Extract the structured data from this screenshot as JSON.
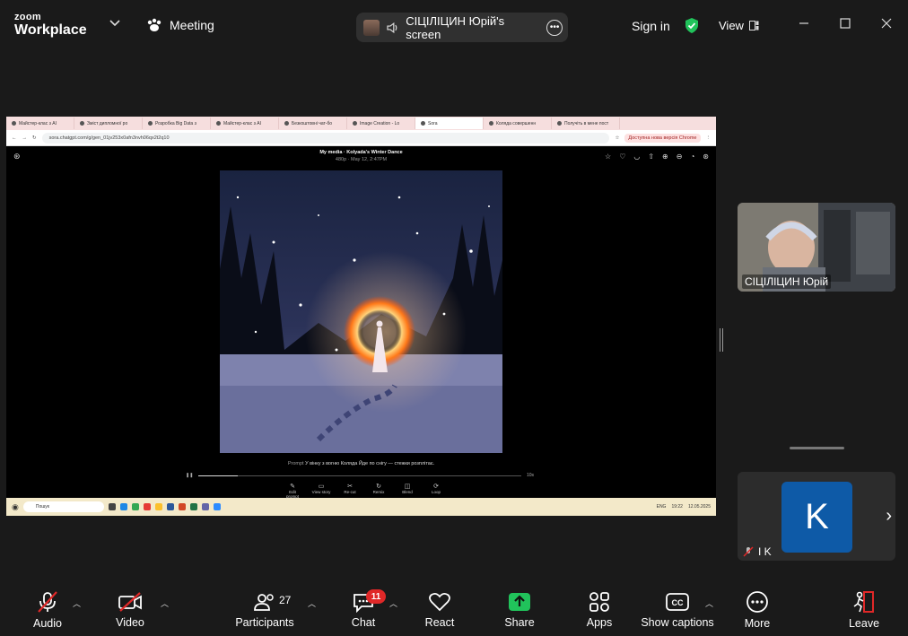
{
  "app": {
    "logo_line1": "zoom",
    "logo_line2": "Workplace",
    "meeting_label": "Meeting"
  },
  "share_banner": {
    "text": "СІЦІЛІЦИН Юрій's screen"
  },
  "header_right": {
    "signin": "Sign in",
    "view": "View"
  },
  "browser": {
    "tabs": [
      {
        "label": "Майстер-клас з AI",
        "active": false
      },
      {
        "label": "Зміст дипломної ро",
        "active": false
      },
      {
        "label": "Розробка Big Data з",
        "active": false
      },
      {
        "label": "Майстер-клас з AI",
        "active": false
      },
      {
        "label": "Безкоштовні чат-бо",
        "active": false
      },
      {
        "label": "Image Creation - Lo",
        "active": false
      },
      {
        "label": "Sora",
        "active": true
      },
      {
        "label": "Коляда совершенн",
        "active": false
      },
      {
        "label": "Получіть в мене пост",
        "active": false
      }
    ],
    "url": "sora.chatgpt.com/g/gen_01jv253x0afn3nvh06qx2t2q10",
    "update_notice": "Доступна нова версія Chrome"
  },
  "sora": {
    "header_title": "My media · Kolyada's Winter Dance",
    "header_meta": "480p · May 12, 2:47PM",
    "prompt_label": "Prompt",
    "prompt_text": "У вінку з вогню Коляда Йде по снігу — стежки розплітає.",
    "duration": "10s",
    "actions": [
      {
        "icon": "edit-icon",
        "label": "Edit prompt"
      },
      {
        "icon": "storyboard-icon",
        "label": "View story"
      },
      {
        "icon": "scissors-icon",
        "label": "Re-cut"
      },
      {
        "icon": "remix-icon",
        "label": "Remix"
      },
      {
        "icon": "blend-icon",
        "label": "Blend"
      },
      {
        "icon": "loop-icon",
        "label": "Loop"
      }
    ],
    "progress": 0.12
  },
  "taskbar": {
    "search_placeholder": "Пошук",
    "lang": "ENG",
    "time": "19:22",
    "date": "12.05.2025"
  },
  "participants": [
    {
      "name": "СІЦІЛІЦИН Юрій"
    },
    {
      "name": "I K",
      "initial": "K",
      "avatar_color": "#0e5aa7"
    }
  ],
  "toolbar": {
    "audio": "Audio",
    "video": "Video",
    "participants": "Participants",
    "participants_count": "27",
    "chat": "Chat",
    "chat_badge": "11",
    "react": "React",
    "share": "Share",
    "apps": "Apps",
    "captions": "Show captions",
    "more": "More",
    "leave": "Leave"
  },
  "colors": {
    "share_green": "#21c35b",
    "leave_red": "#e02828",
    "badge_red": "#e02828"
  }
}
